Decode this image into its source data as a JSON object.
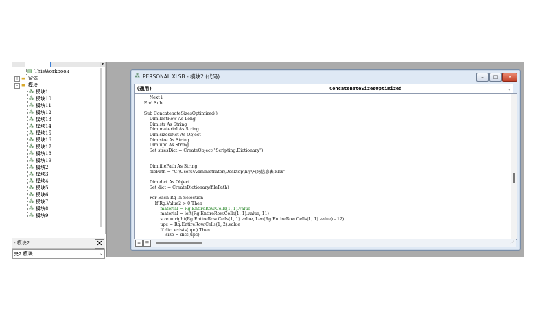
{
  "explorer": {
    "nodes": [
      {
        "label": "ThisWorkbook",
        "icon": "sheet-icon"
      },
      {
        "label": "窗体",
        "icon": "folder-icon",
        "expander": "+"
      },
      {
        "label": "模块",
        "icon": "folder-icon",
        "expander": "-"
      },
      {
        "label": "模块1",
        "icon": "module-icon"
      },
      {
        "label": "模块10",
        "icon": "module-icon"
      },
      {
        "label": "模块11",
        "icon": "module-icon"
      },
      {
        "label": "模块12",
        "icon": "module-icon"
      },
      {
        "label": "模块13",
        "icon": "module-icon"
      },
      {
        "label": "模块14",
        "icon": "module-icon"
      },
      {
        "label": "模块15",
        "icon": "module-icon"
      },
      {
        "label": "模块16",
        "icon": "module-icon"
      },
      {
        "label": "模块17",
        "icon": "module-icon"
      },
      {
        "label": "模块18",
        "icon": "module-icon"
      },
      {
        "label": "模块19",
        "icon": "module-icon"
      },
      {
        "label": "模块2",
        "icon": "module-icon"
      },
      {
        "label": "模块3",
        "icon": "module-icon"
      },
      {
        "label": "模块4",
        "icon": "module-icon"
      },
      {
        "label": "模块5",
        "icon": "module-icon"
      },
      {
        "label": "模块6",
        "icon": "module-icon"
      },
      {
        "label": "模块7",
        "icon": "module-icon"
      },
      {
        "label": "模块8",
        "icon": "module-icon"
      },
      {
        "label": "模块9",
        "icon": "module-icon"
      }
    ]
  },
  "properties": {
    "title": "- 模块2",
    "close": "✕",
    "selected": "夬2 模块"
  },
  "codewindow": {
    "title": "PERSONAL.XLSB - 模块2 (代码)",
    "object_combo": "(通用)",
    "proc_combo": "ConcatenateSizesOptimized",
    "buttons": {
      "minimize": "–",
      "restore": "□",
      "close": "✕"
    }
  },
  "code": {
    "lines": [
      "        Next i",
      "    End Sub",
      "",
      "    Sub ConcatenateSizesOptimized()",
      "        Dim lastRow As Long",
      "        Dim str As String",
      "        Dim material As String",
      "        Dim sizesDict As Object",
      "        Dim size As String",
      "        Dim upc As String",
      "        Set sizesDict = CreateObject(\"Scripting.Dictionary\")",
      "",
      "",
      "        Dim filePath As String",
      "        filePath = \"C:\\Users\\Administrator\\Desktop\\lily\\尺码信息表.xlsx\"",
      "",
      "        Dim dict As Object",
      "        Set dict = CreateDictionary(filePath)",
      "",
      "        For Each Rg In Selection",
      "            If Rg.Value2 > 0 Then",
      "                material = Rg.EntireRow.Cells(1, 1).value",
      "                material = left(Rg.EntireRow.Cells(1, 1).value, 11)",
      "                size = right(Rg.EntireRow.Cells(1, 1).value, Len(Rg.EntireRow.Cells(1, 1).value) - 12)",
      "                upc = Rg.EntireRow.Cells(1, 2).value",
      "                If dict.exists(upc) Then",
      "                    size = dict(upc)"
    ]
  },
  "colors": {
    "mdi_background": "#ababab",
    "keyword": "#00008b",
    "highlighted_line": "#1a7f1a",
    "close_button": "#c4432a"
  }
}
